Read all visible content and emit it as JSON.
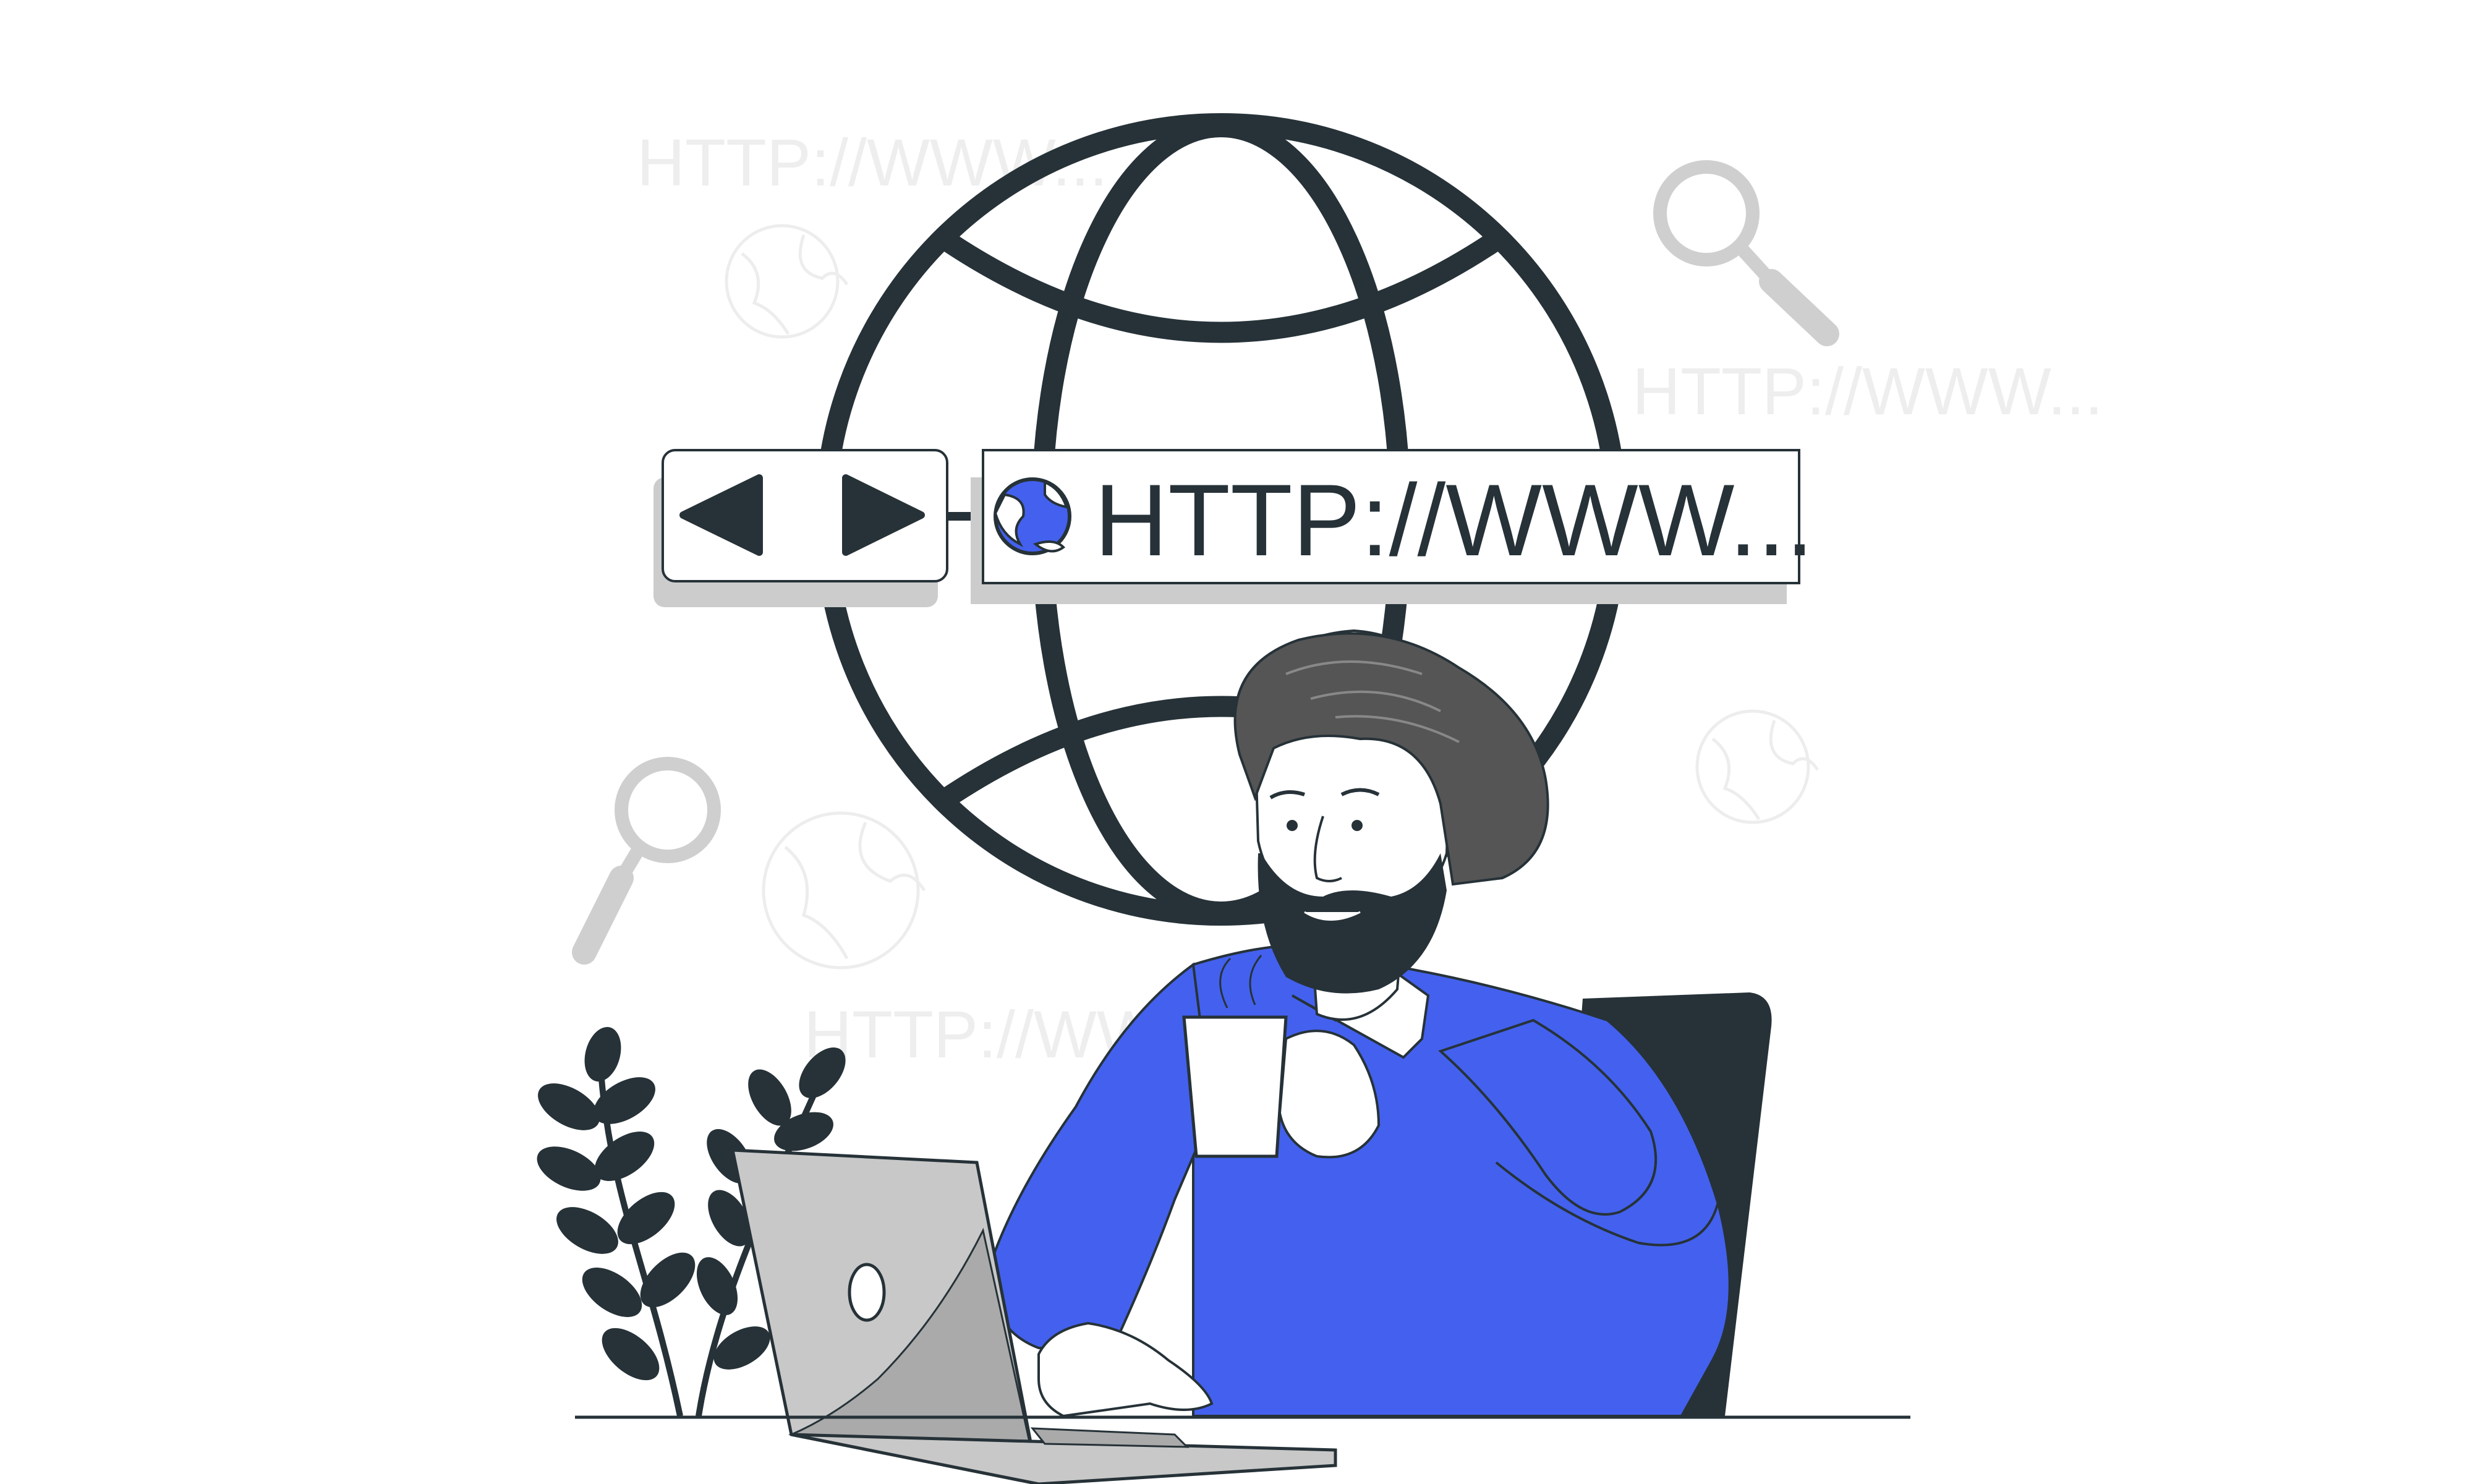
{
  "browser_bar": {
    "url_text": "HTTP://WWW...",
    "back_label": "◀",
    "forward_label": "▶"
  },
  "background_texts": [
    "HTTP://WWW...",
    "HTTP://WWW...",
    "HTTP://WWW..."
  ],
  "icons": [
    "globe-icon",
    "back-arrow-icon",
    "forward-arrow-icon",
    "magnifier-icon",
    "plant-icon",
    "laptop-icon",
    "coffee-mug-icon"
  ],
  "colors": {
    "accent_blue": "#4361EE",
    "dark": "#263238",
    "hair": "#555555",
    "laptop": "#C8C8C8",
    "faded": "#D6D6D6"
  }
}
